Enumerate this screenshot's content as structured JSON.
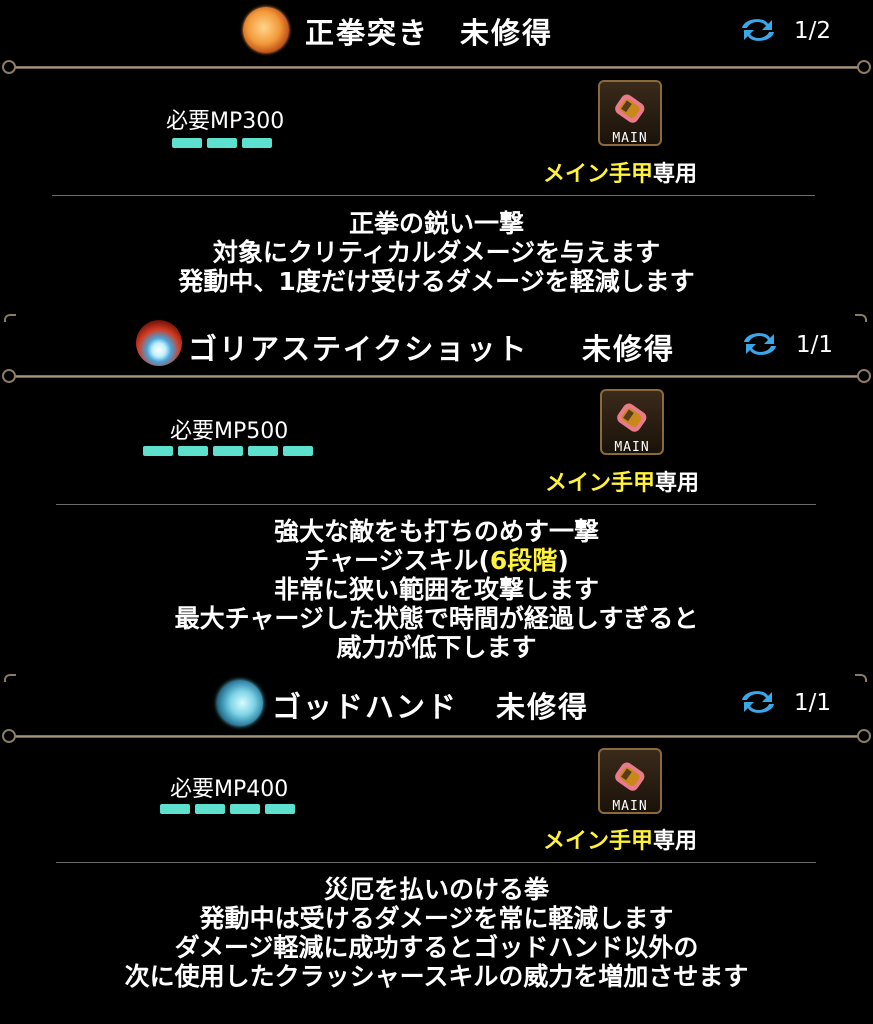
{
  "skills": [
    {
      "name": "正拳突き",
      "status": "未修得",
      "icon": "fist-icon",
      "page": "1/2",
      "mp_label": "必要MP300",
      "mp_segments": 3,
      "equip_tag": "MAIN",
      "equip_req_main": "メイン手甲",
      "equip_req_suffix": "専用",
      "desc": [
        "正拳の鋭い一撃",
        "対象にクリティカルダメージを与えます",
        "発動中、1度だけ受けるダメージを軽減します"
      ]
    },
    {
      "name": "ゴリアステイクショット",
      "status": "未修得",
      "icon": "gorilla-stake-icon",
      "page": "1/1",
      "mp_label": "必要MP500",
      "mp_segments": 5,
      "equip_tag": "MAIN",
      "equip_req_main": "メイン手甲",
      "equip_req_suffix": "専用",
      "desc": [
        "強大な敵をも打ちのめす一撃",
        "チャージスキル(",
        "6段階",
        ")",
        "非常に狭い範囲を攻撃します",
        "最大チャージした状態で時間が経過しすぎると",
        "威力が低下します"
      ]
    },
    {
      "name": "ゴッドハンド",
      "status": "未修得",
      "icon": "god-hand-icon",
      "page": "1/1",
      "mp_label": "必要MP400",
      "mp_segments": 4,
      "equip_tag": "MAIN",
      "equip_req_main": "メイン手甲",
      "equip_req_suffix": "専用",
      "desc": [
        "災厄を払いのける拳",
        "発動中は受けるダメージを常に軽減します",
        "ダメージ軽減に成功するとゴッドハンド以外の",
        "次に使用したクラッシャースキルの威力を増加させます"
      ]
    }
  ],
  "colors": {
    "mp_bar": "#5ee0cf",
    "highlight": "#fff23a",
    "frame": "#b9a58a"
  }
}
